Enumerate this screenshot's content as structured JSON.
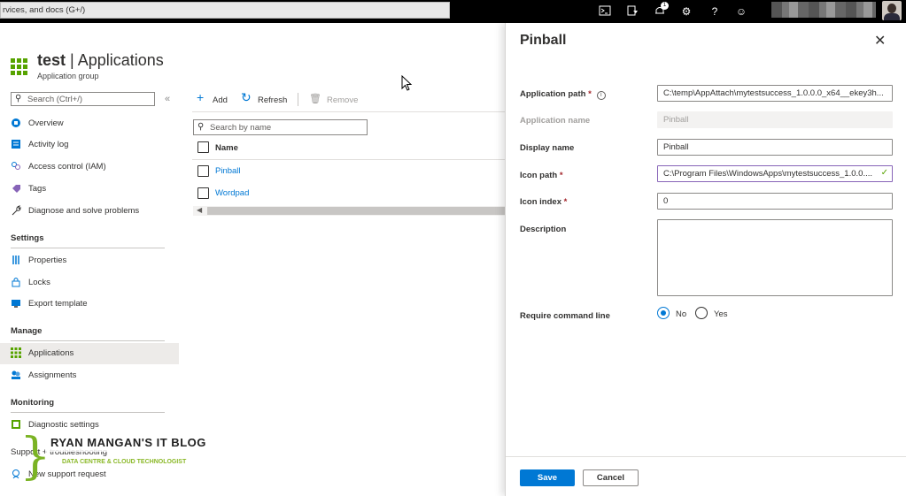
{
  "topbar": {
    "search_text": "rvices, and docs (G+/)",
    "notification_count": "1",
    "icons": [
      "cloud-shell-icon",
      "directory-filter-icon",
      "notifications-icon",
      "settings-icon",
      "help-icon",
      "feedback-icon"
    ]
  },
  "resource": {
    "name": "test",
    "separator": " | ",
    "page": "Applications",
    "subtitle": "Application group"
  },
  "nav": {
    "search_placeholder": "Search (Ctrl+/)",
    "items": [
      {
        "label": "Overview",
        "icon": "overview-icon"
      },
      {
        "label": "Activity log",
        "icon": "activity-log-icon"
      },
      {
        "label": "Access control (IAM)",
        "icon": "iam-icon"
      },
      {
        "label": "Tags",
        "icon": "tag-icon"
      },
      {
        "label": "Diagnose and solve problems",
        "icon": "wrench-icon"
      }
    ],
    "sections": {
      "settings": "Settings",
      "manage": "Manage",
      "monitoring": "Monitoring",
      "support": "Support + troubleshooting"
    },
    "settings_items": [
      {
        "label": "Properties",
        "icon": "properties-icon"
      },
      {
        "label": "Locks",
        "icon": "lock-icon"
      },
      {
        "label": "Export template",
        "icon": "export-template-icon"
      }
    ],
    "manage_items": [
      {
        "label": "Applications",
        "icon": "applications-icon",
        "selected": true
      },
      {
        "label": "Assignments",
        "icon": "assignments-icon"
      }
    ],
    "monitoring_items": [
      {
        "label": "Diagnostic settings",
        "icon": "diagnostic-settings-icon"
      }
    ],
    "support_items": [
      {
        "label": "New support request",
        "icon": "support-request-icon"
      }
    ]
  },
  "watermark": {
    "title": "RYAN MANGAN'S IT BLOG",
    "subtitle": "DATA CENTRE & CLOUD TECHNOLOGIST"
  },
  "toolbar": {
    "add_label": "Add",
    "refresh_label": "Refresh",
    "remove_label": "Remove"
  },
  "apps": {
    "search_placeholder": "Search by name",
    "column_name": "Name",
    "rows": [
      "Pinball",
      "Wordpad"
    ]
  },
  "blade": {
    "title": "Pinball",
    "fields": {
      "app_path_label": "Application path",
      "app_path_value": "C:\\temp\\AppAttach\\mytestsuccess_1.0.0.0_x64__ekey3h...",
      "app_name_label": "Application name",
      "app_name_value": "Pinball",
      "display_name_label": "Display name",
      "display_name_value": "Pinball",
      "icon_path_label": "Icon path",
      "icon_path_value": "C:\\Program Files\\WindowsApps\\mytestsuccess_1.0.0....",
      "icon_index_label": "Icon index",
      "icon_index_value": "0",
      "description_label": "Description",
      "description_value": "",
      "cmdline_label": "Require command line",
      "cmdline_options": [
        "No",
        "Yes"
      ],
      "cmdline_selected": "No"
    },
    "required_marker": "*",
    "save_label": "Save",
    "cancel_label": "Cancel"
  },
  "colors": {
    "accent": "#0078d4",
    "resource_icon": "#57a300",
    "focus_border": "#8764b8",
    "required": "#a4262c"
  }
}
